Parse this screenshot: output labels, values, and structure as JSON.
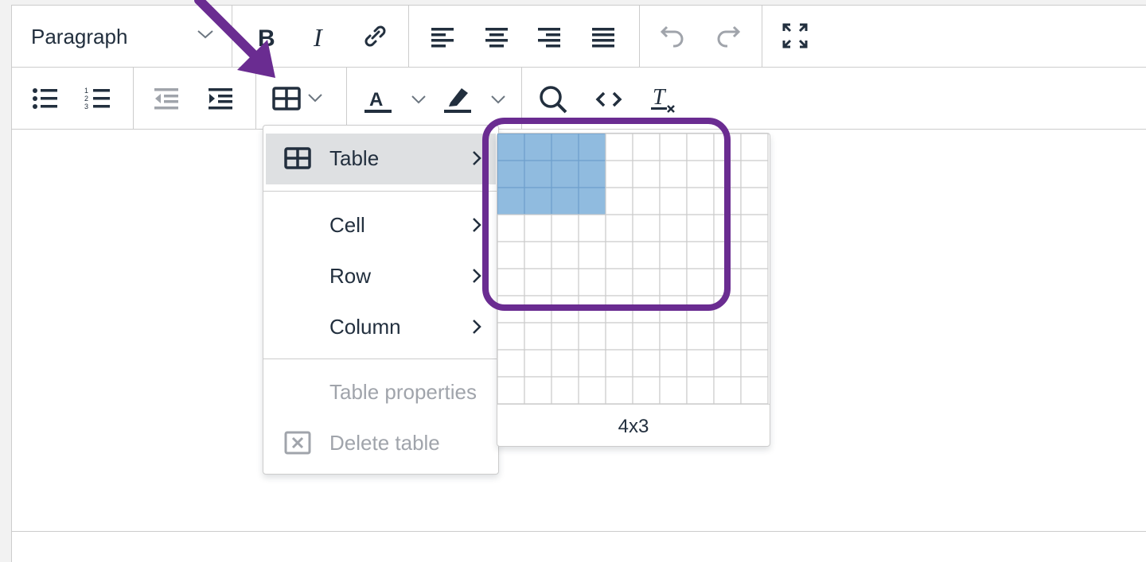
{
  "toolbar": {
    "block_format": "Paragraph",
    "row1": [
      "bold",
      "italic",
      "link",
      "align-left",
      "align-center",
      "align-right",
      "align-justify",
      "undo",
      "redo",
      "fullscreen"
    ],
    "row2": [
      "bullet-list",
      "numbered-list",
      "outdent",
      "indent",
      "table",
      "text-color",
      "highlight-color",
      "search",
      "source-code",
      "clear-formatting"
    ]
  },
  "table_menu": {
    "items": [
      {
        "label": "Table",
        "icon": "table-icon",
        "submenu": true,
        "active": true
      },
      {
        "label": "Cell",
        "submenu": true
      },
      {
        "label": "Row",
        "submenu": true
      },
      {
        "label": "Column",
        "submenu": true
      },
      {
        "label": "Table properties",
        "disabled": true
      },
      {
        "label": "Delete table",
        "icon": "delete-table-icon",
        "disabled": true
      }
    ]
  },
  "grid_picker": {
    "columns": 10,
    "rows": 10,
    "selected_columns": 4,
    "selected_rows": 3,
    "label": "4x3"
  },
  "colors": {
    "annotation": "#6a2c91",
    "grid_selected": "#90bbdf",
    "grid_selected_border": "#6fa0cc",
    "grid_line": "#cccccc",
    "menu_active_bg": "#dee0e2",
    "text": "#222f3e",
    "disabled_text": "#a0a4ab"
  }
}
